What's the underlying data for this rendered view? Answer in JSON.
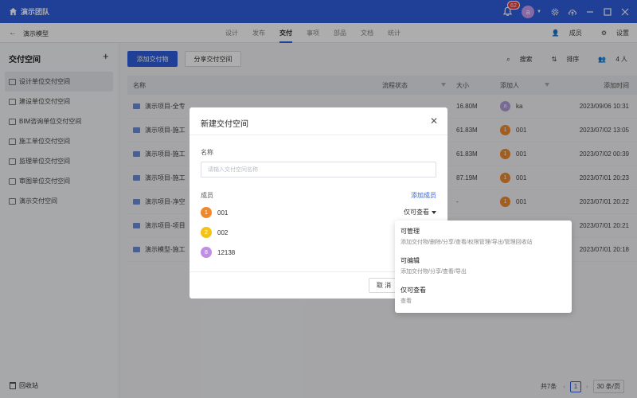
{
  "topbar": {
    "team_name": "演示团队",
    "notification_count": "62",
    "avatar_letter": "a"
  },
  "subbar": {
    "project_name": "演示模型",
    "tabs": [
      "设计",
      "发布",
      "交付",
      "事项",
      "部品",
      "文档",
      "统计"
    ],
    "active_tab": "交付",
    "members_label": "成员",
    "settings_label": "设置"
  },
  "sidebar": {
    "title": "交付空间",
    "items": [
      "设计单位交付空间",
      "建设单位交付空间",
      "BIM咨询单位交付空间",
      "施工单位交付空间",
      "监理单位交付空间",
      "审图单位交付空间",
      "演示交付空间"
    ],
    "recycle_bin": "回收站"
  },
  "main": {
    "add_button": "添加交付物",
    "share_button": "分享交付空间",
    "search_label": "搜索",
    "sort_label": "排序",
    "people_count": "4 人",
    "columns": {
      "name": "名称",
      "status": "流程状态",
      "size": "大小",
      "adder": "添加人",
      "time": "添加时间"
    },
    "rows": [
      {
        "name": "演示项目-全专",
        "size": "16.80M",
        "user_letter": "a",
        "user": "ka",
        "user_color": "#b39ddb",
        "time": "2023/09/06 10:31"
      },
      {
        "name": "演示项目-施工",
        "size": "61.83M",
        "user_letter": "1",
        "user": "001",
        "user_color": "#f0892b",
        "time": "2023/07/02 13:05"
      },
      {
        "name": "演示项目-施工",
        "size": "61.83M",
        "user_letter": "1",
        "user": "001",
        "user_color": "#f0892b",
        "time": "2023/07/02 00:39"
      },
      {
        "name": "演示项目-施工",
        "size": "87.19M",
        "user_letter": "1",
        "user": "001",
        "user_color": "#f0892b",
        "time": "2023/07/01 20:23"
      },
      {
        "name": "演示项目-净空",
        "size": "-",
        "user_letter": "1",
        "user": "001",
        "user_color": "#f0892b",
        "time": "2023/07/01 20:22"
      },
      {
        "name": "演示项目-项目",
        "size": "",
        "user_letter": "",
        "user": "",
        "user_color": "",
        "time": "2023/07/01 20:21"
      },
      {
        "name": "演示模型-施工",
        "size": "",
        "user_letter": "",
        "user": "",
        "user_color": "",
        "time": "2023/07/01 20:18"
      }
    ],
    "pagination": {
      "total": "共7条",
      "current_page": "1",
      "page_size": "30 条/页"
    }
  },
  "modal": {
    "title": "新建交付空间",
    "name_label": "名称",
    "name_placeholder": "请输入交付空间名称",
    "members_label": "成员",
    "add_member": "添加成员",
    "members": [
      {
        "letter": "1",
        "name": "001",
        "color": "#f0892b"
      },
      {
        "letter": "2",
        "name": "002",
        "color": "#f2c318"
      },
      {
        "letter": "8",
        "name": "12138",
        "color": "#c08ee6"
      }
    ],
    "permission_value": "仅可查看",
    "cancel_button": "取 消"
  },
  "dropdown": {
    "options": [
      {
        "title": "可管理",
        "desc": "添加交付物/删除/分享/查看/权限管理/导出/管理回收站"
      },
      {
        "title": "可编辑",
        "desc": "添加交付物/分享/查看/导出"
      },
      {
        "title": "仅可查看",
        "desc": "查看"
      }
    ]
  },
  "colors": {
    "primary": "#2f5fde",
    "badge": "#f03c3c"
  }
}
